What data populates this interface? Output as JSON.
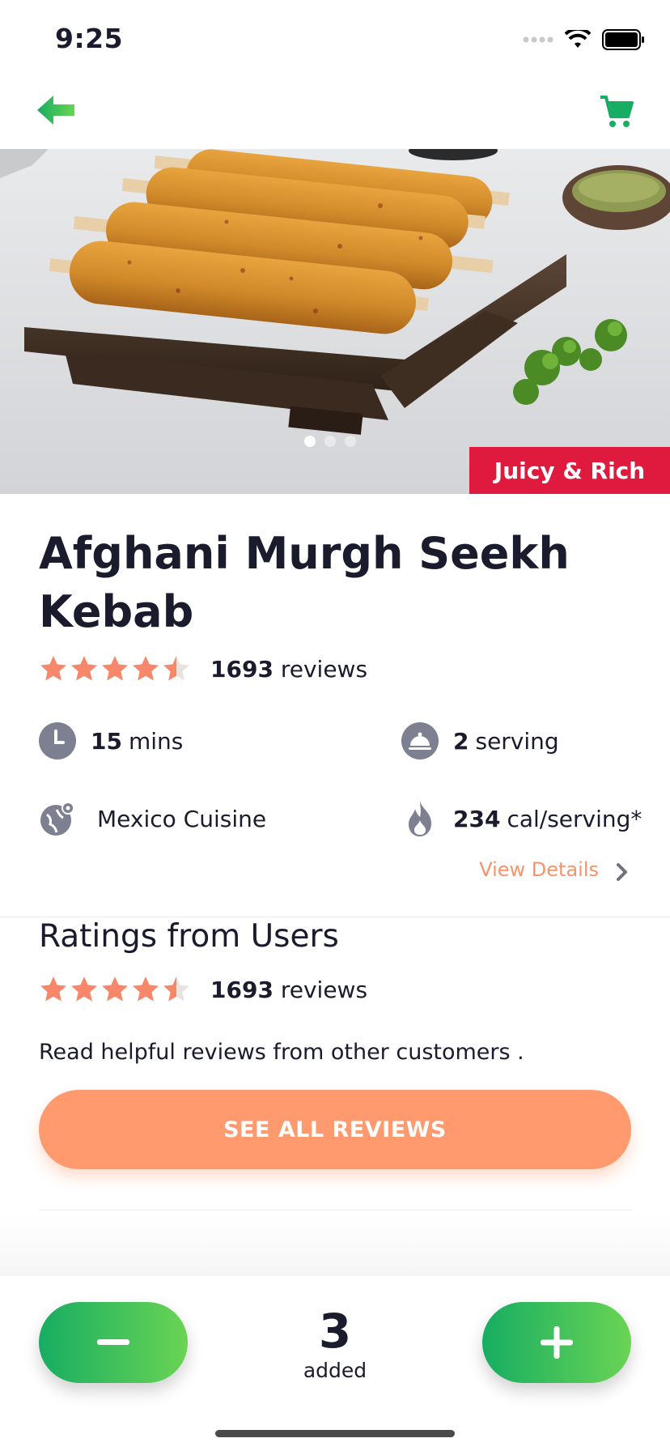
{
  "status_bar": {
    "time": "9:25"
  },
  "colors": {
    "accent_green": "#17ad62",
    "accent_orange": "#ff9a6e",
    "tag_red": "#e0193e",
    "star_orange": "#f7876a",
    "text_dark": "#1b1b2e"
  },
  "product": {
    "tag": "Juicy & Rich",
    "title": "Afghani Murgh Seekh Kebab",
    "rating": 4.5,
    "review_count": "1693",
    "reviews_word": "reviews",
    "carousel": {
      "pages": 3,
      "active": 1
    },
    "meta": {
      "time_value": "15",
      "time_unit": "mins",
      "serving_value": "2",
      "serving_unit": "serving",
      "cuisine": "Mexico Cuisine",
      "calories_value": "234",
      "calories_unit": "cal/serving*"
    },
    "view_details": "View Details"
  },
  "ratings_section": {
    "title": "Ratings from Users",
    "rating": 4.5,
    "review_count": "1693",
    "reviews_word": "reviews",
    "help_text": "Read helpful reviews from other customers .",
    "see_all_label": "SEE ALL REVIEWS"
  },
  "cart_stepper": {
    "quantity": "3",
    "label": "added"
  },
  "icons": [
    "back-arrow-icon",
    "cart-icon",
    "clock-icon",
    "serving-cloche-icon",
    "globe-pin-icon",
    "flame-icon",
    "chevron-right-icon",
    "star-icon",
    "minus-icon",
    "plus-icon",
    "signal-icon",
    "wifi-icon",
    "battery-icon"
  ]
}
